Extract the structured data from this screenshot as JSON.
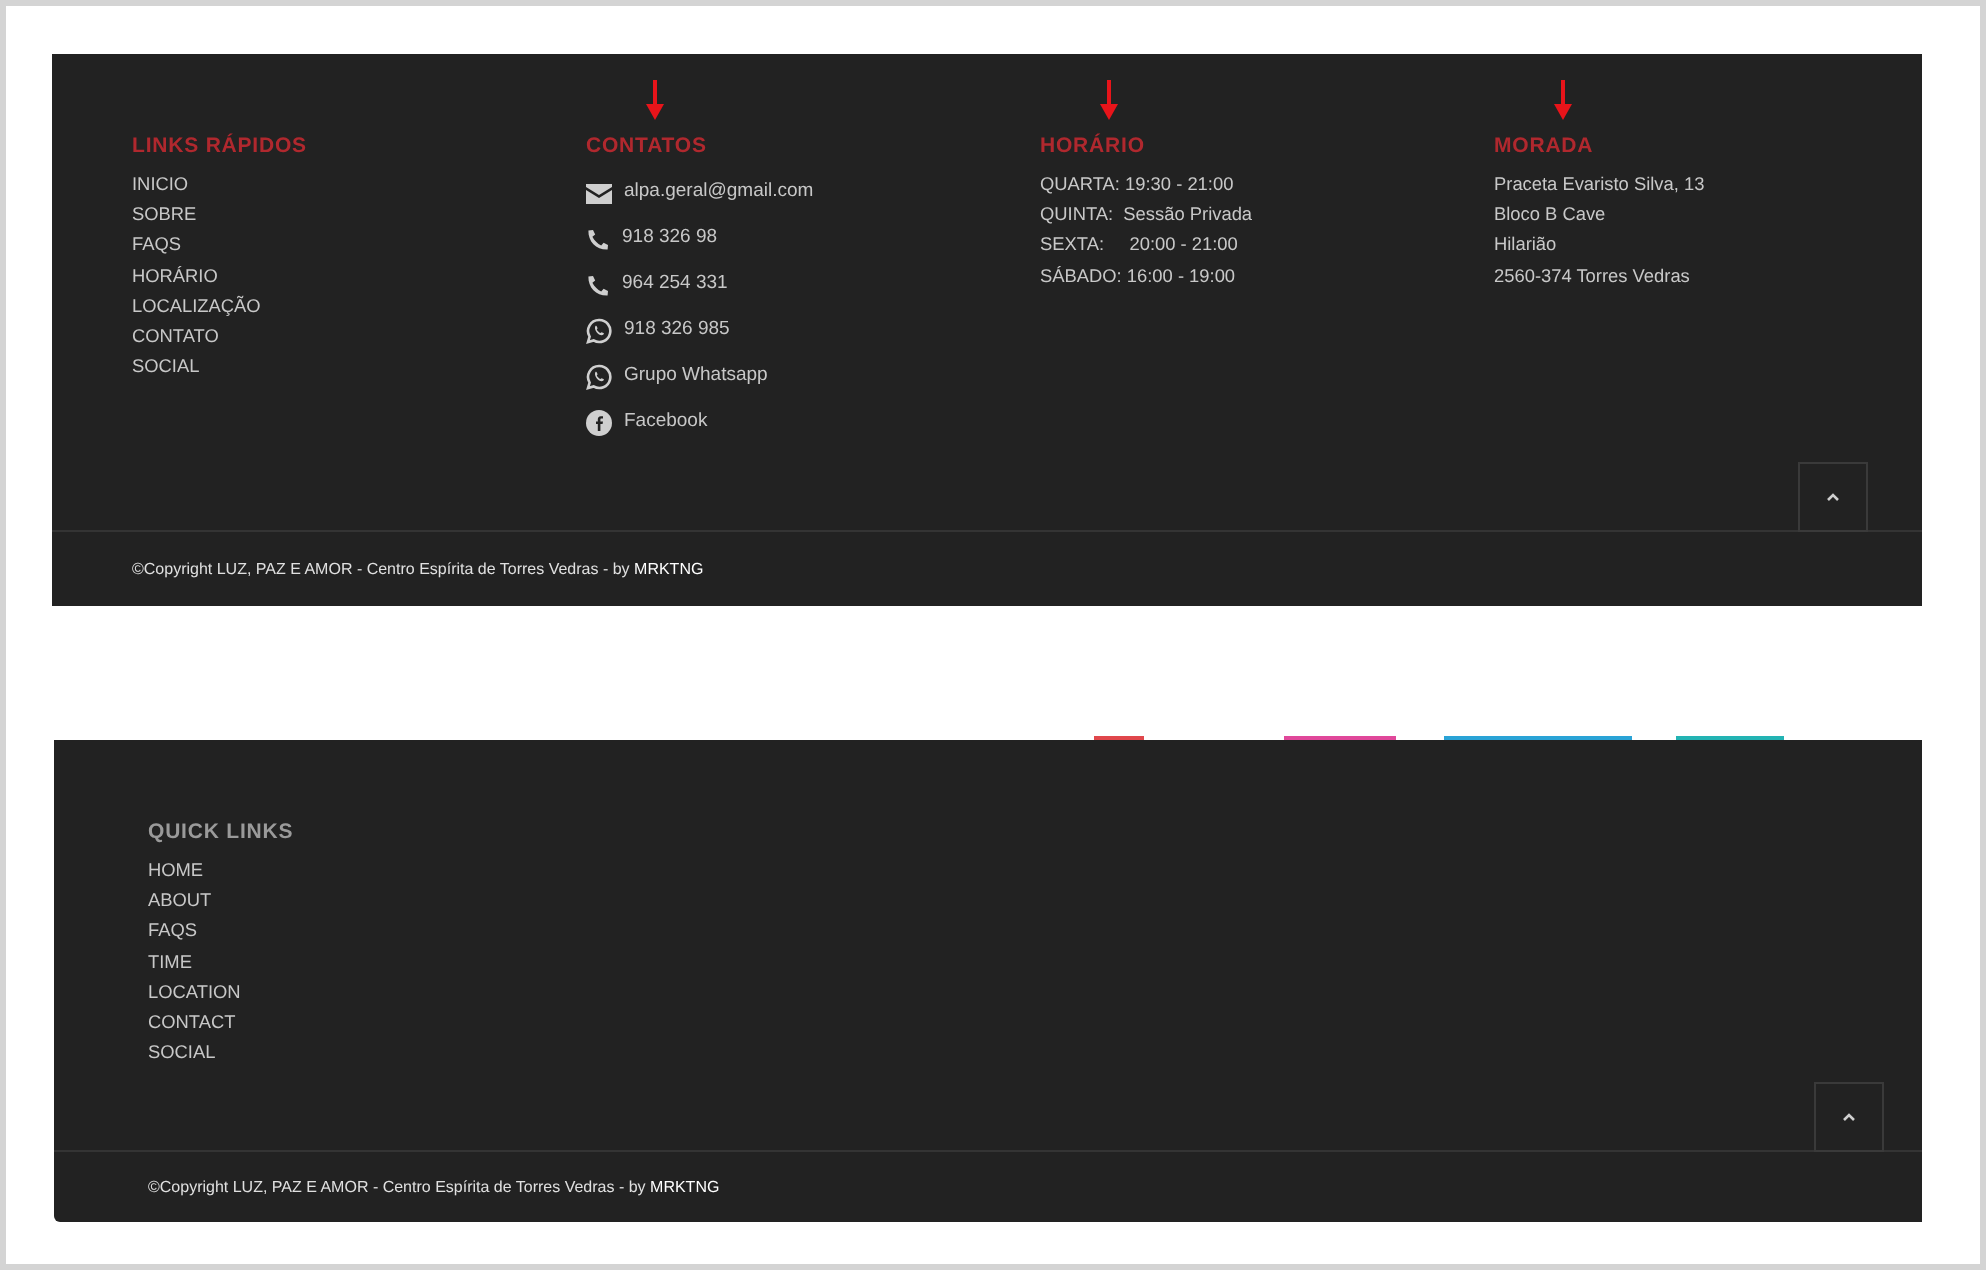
{
  "footers": [
    {
      "columns": [
        {
          "heading": "LINKS RÁPIDOS",
          "color": "#b0282e",
          "marked": false,
          "kind": "links",
          "items": [
            {
              "text": "INICIO"
            },
            {
              "text": "SOBRE"
            },
            {
              "text": "FAQS"
            },
            {
              "text": "HORÁRIO"
            },
            {
              "text": "LOCALIZAÇÃO"
            },
            {
              "text": "CONTATO"
            },
            {
              "text": "SOCIAL"
            }
          ]
        },
        {
          "heading": "CONTATOS",
          "color": "#b0282e",
          "marked": true,
          "kind": "contacts",
          "items": [
            {
              "kind": "email",
              "text": "alpa.geral@gmail.com"
            },
            {
              "kind": "phone",
              "text": "918 326 98"
            },
            {
              "kind": "phone",
              "text": "964 254 331"
            },
            {
              "kind": "whatsapp",
              "text": "918 326 985"
            },
            {
              "kind": "whatsapp",
              "text": "Grupo Whatsapp"
            },
            {
              "kind": "facebook",
              "text": "Facebook"
            }
          ]
        },
        {
          "heading": "HORÁRIO",
          "color": "#b0282e",
          "marked": true,
          "kind": "text",
          "items": [
            {
              "text": "QUARTA: 19:30 - 21:00"
            },
            {
              "text": "QUINTA:  Sessão Privada"
            },
            {
              "text": "SEXTA:     20:00 - 21:00"
            },
            {
              "text": "SÁBADO: 16:00 - 19:00"
            }
          ]
        },
        {
          "heading": "MORADA",
          "color": "#b0282e",
          "marked": true,
          "kind": "text",
          "items": [
            {
              "text": "Praceta Evaristo Silva, 13"
            },
            {
              "text": "Bloco B Cave"
            },
            {
              "text": "Hilarião"
            },
            {
              "text": "2560-374 Torres Vedras"
            }
          ]
        }
      ],
      "copyright": "©Copyright LUZ, PAZ E AMOR - Centro Espírita de Torres Vedras - by ",
      "credit": "MRKTNG"
    },
    {
      "columns": [
        {
          "heading": "QUICK LINKS",
          "color": "#9a9a9a",
          "marked": false,
          "kind": "links",
          "items": [
            {
              "text": "HOME"
            },
            {
              "text": "ABOUT"
            },
            {
              "text": "FAQS"
            },
            {
              "text": "TIME"
            },
            {
              "text": "LOCATION"
            },
            {
              "text": "CONTACT"
            },
            {
              "text": "SOCIAL"
            }
          ]
        }
      ],
      "copyright": "©Copyright LUZ, PAZ E AMOR - Centro Espírita de Torres Vedras - by ",
      "credit": "MRKTNG"
    }
  ]
}
